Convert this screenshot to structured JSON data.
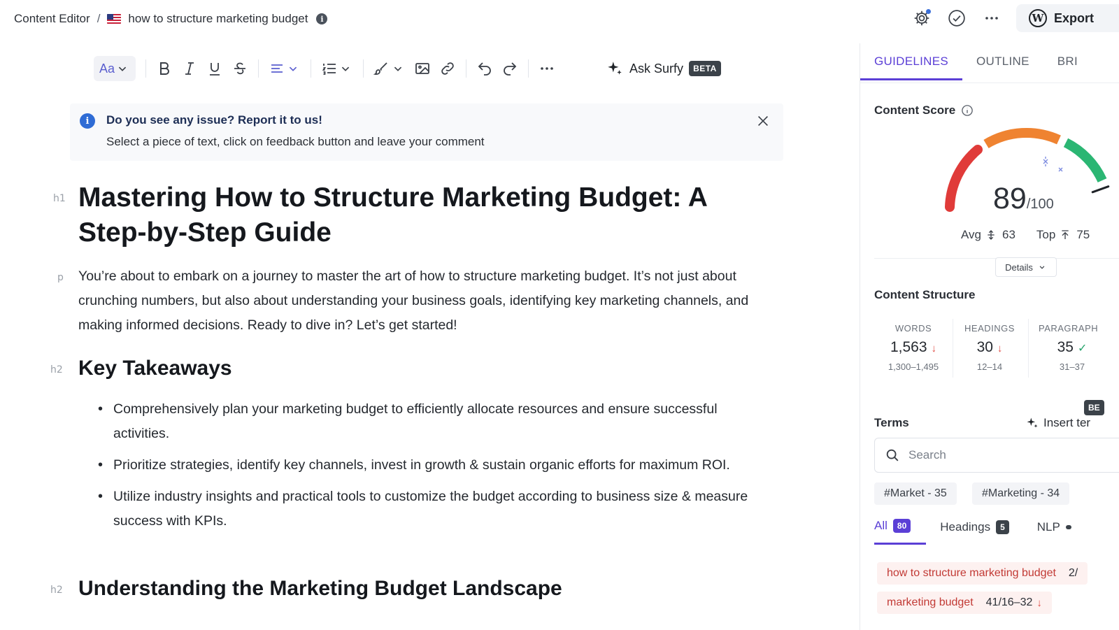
{
  "breadcrumb": {
    "root": "Content Editor",
    "separator": "/",
    "document": "how to structure marketing budget"
  },
  "top_actions": {
    "export_label": "Export"
  },
  "toolbar": {
    "font_label": "Aa",
    "ask_label": "Ask Surfy",
    "beta_label": "BETA"
  },
  "notice": {
    "title": "Do you see any issue? Report it to us!",
    "body": "Select a piece of text, click on feedback button and leave your comment"
  },
  "editor": {
    "blocks": [
      {
        "tag": "h1",
        "text": "Mastering How to Structure Marketing Budget: A Step-by-Step Guide"
      },
      {
        "tag": "p",
        "text": "You’re about to embark on a journey to master the art of how to structure marketing budget. It’s not just about crunching numbers, but also about understanding your business goals, identifying key marketing channels, and making informed decisions. Ready to dive in? Let’s get started!"
      },
      {
        "tag": "h2",
        "text": "Key Takeaways"
      },
      {
        "tag": "h2",
        "text": "Understanding the Marketing Budget Landscape"
      }
    ],
    "takeaways": [
      "Comprehensively plan your marketing budget to efficiently allocate resources and ensure successful activities.",
      "Prioritize strategies, identify key channels, invest in growth & sustain organic efforts for maximum ROI.",
      "Utilize industry insights and practical tools to customize the budget according to business size & measure success with KPIs."
    ]
  },
  "panel": {
    "tabs": [
      "GUIDELINES",
      "OUTLINE",
      "BRI"
    ],
    "content_score": {
      "title": "Content Score",
      "value": "89",
      "max": "/100",
      "avg_label": "Avg",
      "avg_value": "63",
      "top_label": "Top",
      "top_value": "75",
      "details_label": "Details",
      "score_fraction": 0.89
    },
    "structure": {
      "title": "Content Structure",
      "metrics": [
        {
          "label": "WORDS",
          "value": "1,563",
          "range": "1,300–1,495",
          "status": "down"
        },
        {
          "label": "HEADINGS",
          "value": "30",
          "range": "12–14",
          "status": "down"
        },
        {
          "label": "PARAGRAPH",
          "value": "35",
          "range": "31–37",
          "status": "ok"
        }
      ]
    },
    "terms": {
      "title": "Terms",
      "badge": "BE",
      "insert_label": "Insert ter",
      "search_placeholder": "Search",
      "chips": [
        "#Market - 35",
        "#Marketing - 34"
      ],
      "filters": [
        {
          "label": "All",
          "count": "80"
        },
        {
          "label": "Headings",
          "count": "5"
        },
        {
          "label": "NLP",
          "count": ""
        }
      ],
      "items": [
        {
          "term": "how to structure marketing budget",
          "usage": "2/"
        },
        {
          "term": "marketing budget",
          "usage": "41/16–32"
        }
      ]
    }
  }
}
